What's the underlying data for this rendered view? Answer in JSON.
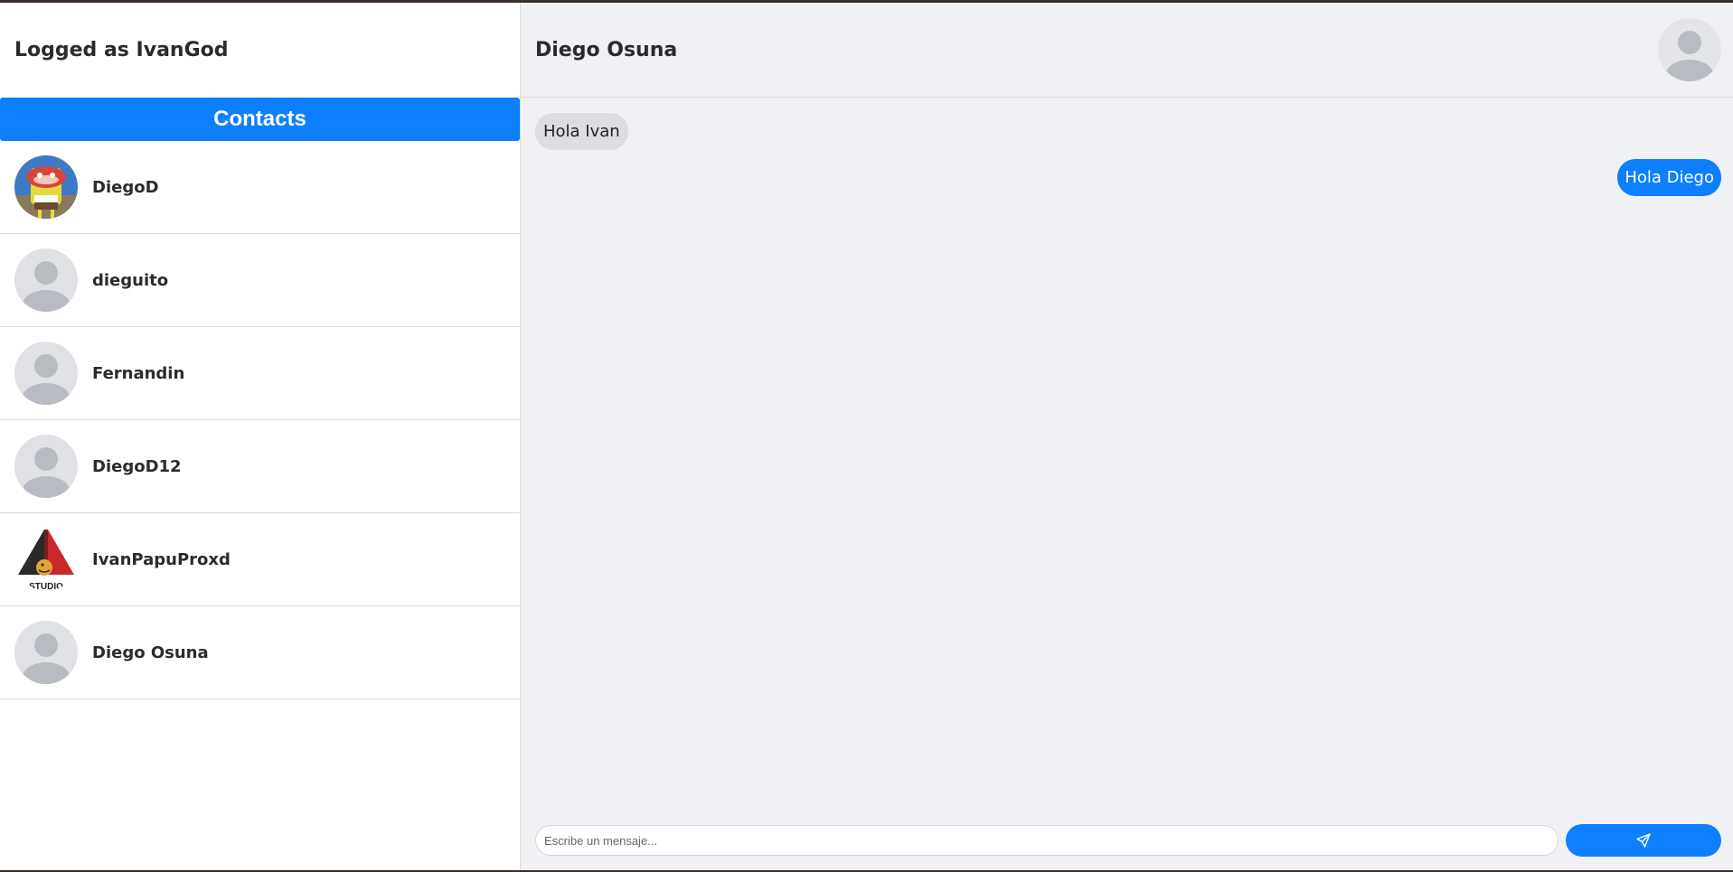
{
  "sidebar": {
    "logged_as": "Logged as IvanGod",
    "contacts_title": "Contacts",
    "contacts": [
      {
        "name": "DiegoD",
        "avatar": "spongebob-avatar"
      },
      {
        "name": "dieguito",
        "avatar": "default-user-avatar"
      },
      {
        "name": "Fernandin",
        "avatar": "default-user-avatar"
      },
      {
        "name": "DiegoD12",
        "avatar": "default-user-avatar"
      },
      {
        "name": "IvanPapuProxd",
        "avatar": "triangle-logo-avatar"
      },
      {
        "name": "Diego Osuna",
        "avatar": "default-user-avatar"
      }
    ]
  },
  "chat": {
    "title": "Diego Osuna",
    "messages": [
      {
        "direction": "incoming",
        "text": "Hola Ivan"
      },
      {
        "direction": "outgoing",
        "text": "Hola Diego"
      }
    ],
    "input": {
      "placeholder": "Escribe un mensaje...",
      "value": ""
    },
    "send_icon": "paper-plane-icon"
  },
  "colors": {
    "accent": "#0d7fff",
    "chat_background": "#eff1f5",
    "incoming_bubble": "#dcdde0",
    "default_avatar_bg": "#dfe1e5",
    "default_avatar_fg": "#b8bcc2"
  }
}
